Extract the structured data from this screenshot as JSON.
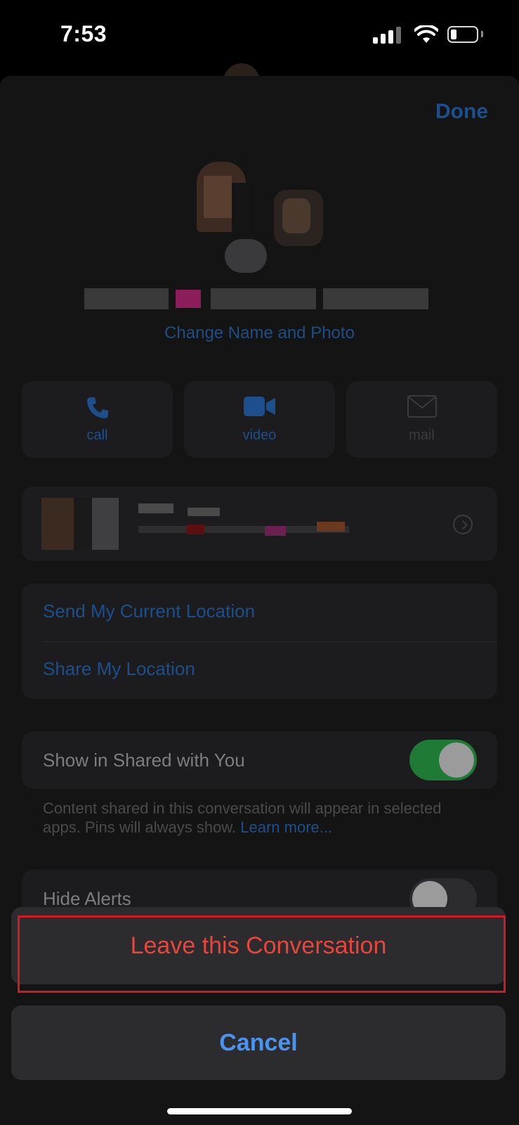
{
  "status_bar": {
    "time": "7:53"
  },
  "header": {
    "done_label": "Done"
  },
  "group": {
    "change_name_photo": "Change Name and Photo"
  },
  "actions": [
    {
      "label": "call",
      "icon": "phone-icon"
    },
    {
      "label": "video",
      "icon": "video-camera-icon"
    },
    {
      "label": "mail",
      "icon": "envelope-icon"
    }
  ],
  "location": {
    "send_current": "Send My Current Location",
    "share": "Share My Location"
  },
  "shared_with_you": {
    "label": "Show in Shared with You",
    "enabled": true,
    "footnote": "Content shared in this conversation will appear in selected apps. Pins will always show.",
    "learn_more": "Learn more..."
  },
  "hide_alerts": {
    "label": "Hide Alerts",
    "enabled": false
  },
  "action_sheet": {
    "leave_label": "Leave this Conversation",
    "cancel_label": "Cancel"
  },
  "colors": {
    "accent_blue": "#4c93f0",
    "destructive_red": "#e8453c",
    "toggle_on_green": "#1f7a35",
    "highlight_box": "#d11a25"
  }
}
